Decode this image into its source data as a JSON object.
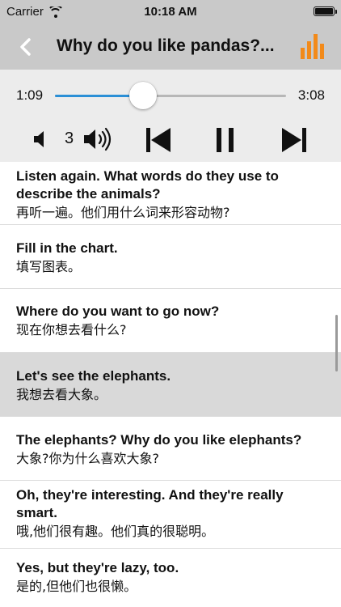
{
  "status_bar": {
    "carrier": "Carrier",
    "time": "10:18 AM"
  },
  "nav": {
    "title": "Why do you like pandas?...",
    "chart_icon_color": "#f28a1a"
  },
  "player": {
    "current_time": "1:09",
    "total_time": "3:08",
    "progress": 0.38,
    "volume_level": "3",
    "accent_color": "#2b8fd6"
  },
  "sentences": [
    {
      "en": "Listen again. What words do they use to describe the animals?",
      "zh": "再听一遍。他们用什么词来形容动物?",
      "selected": false
    },
    {
      "en": "Fill in the chart.",
      "zh": "填写图表。",
      "selected": false
    },
    {
      "en": "Where do you want to go now?",
      "zh": "现在你想去看什么?",
      "selected": false
    },
    {
      "en": "Let's see the elephants.",
      "zh": "我想去看大象。",
      "selected": true
    },
    {
      "en": "The elephants? Why do you like elephants?",
      "zh": "大象?你为什么喜欢大象?",
      "selected": false
    },
    {
      "en": "Oh, they're interesting. And they're really smart.",
      "zh": "哦,他们很有趣。他们真的很聪明。",
      "selected": false
    },
    {
      "en": "Yes, but they're lazy, too.",
      "zh": "是的,但他们也很懒。",
      "selected": false
    }
  ]
}
